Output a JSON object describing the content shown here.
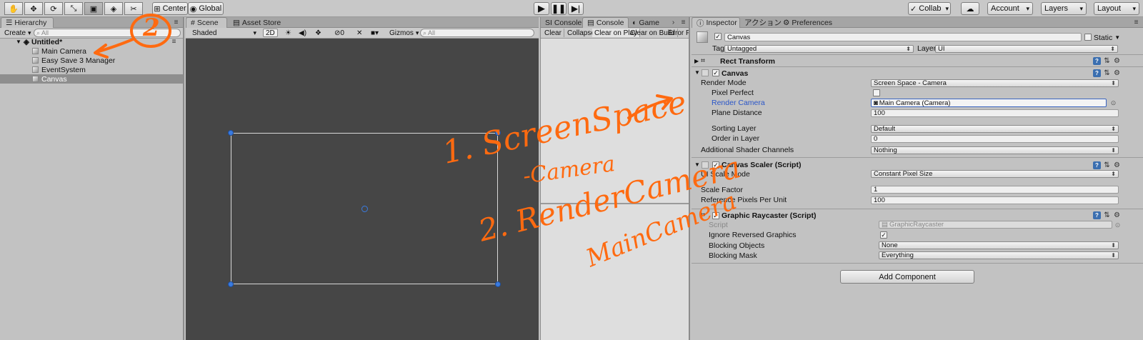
{
  "toolbar": {
    "tools": [
      "hand-tool",
      "move-tool",
      "rotate-tool",
      "scale-tool",
      "rect-tool",
      "transform-tool",
      "custom-tool"
    ],
    "pivot_label": "Center",
    "space_label": "Global",
    "collab_label": "Collab",
    "account_label": "Account",
    "layers_label": "Layers",
    "layout_label": "Layout"
  },
  "hierarchy": {
    "tab_label": "Hierarchy",
    "create_label": "Create",
    "search_placeholder": "All",
    "scene_name": "Untitled*",
    "items": [
      "Main Camera",
      "Easy Save 3 Manager",
      "EventSystem",
      "Canvas"
    ]
  },
  "scene": {
    "tabs": [
      "Scene",
      "Asset Store"
    ],
    "shading_mode": "Shaded",
    "mode_2d": "2D",
    "fx_count": "0",
    "gizmos_label": "Gizmos",
    "search_placeholder": "All"
  },
  "console": {
    "tabs": [
      "SI Console",
      "Console",
      "Game"
    ],
    "buttons": [
      "Clear",
      "Collapse",
      "Clear on Play",
      "Clear on Build",
      "Error Pause"
    ]
  },
  "inspector": {
    "tabs": [
      "Inspector",
      "アクション",
      "Preferences"
    ],
    "object_name": "Canvas",
    "static_label": "Static",
    "tag_label": "Tag",
    "tag_value": "Untagged",
    "layer_label": "Layer",
    "layer_value": "UI",
    "rect_transform": "Rect Transform",
    "canvas": {
      "title": "Canvas",
      "render_mode_label": "Render Mode",
      "render_mode_value": "Screen Space - Camera",
      "pixel_perfect_label": "Pixel Perfect",
      "render_camera_label": "Render Camera",
      "render_camera_value": "Main Camera (Camera)",
      "plane_distance_label": "Plane Distance",
      "plane_distance_value": "100",
      "sorting_layer_label": "Sorting Layer",
      "sorting_layer_value": "Default",
      "order_in_layer_label": "Order in Layer",
      "order_in_layer_value": "0",
      "shader_channels_label": "Additional Shader Channels",
      "shader_channels_value": "Nothing"
    },
    "canvas_scaler": {
      "title": "Canvas Scaler (Script)",
      "ui_scale_mode_label": "UI Scale Mode",
      "ui_scale_mode_value": "Constant Pixel Size",
      "scale_factor_label": "Scale Factor",
      "scale_factor_value": "1",
      "ref_ppu_label": "Reference Pixels Per Unit",
      "ref_ppu_value": "100"
    },
    "graphic_raycaster": {
      "title": "Graphic Raycaster (Script)",
      "script_label": "Script",
      "script_value": "GraphicRaycaster",
      "ignore_reversed_label": "Ignore Reversed Graphics",
      "blocking_objects_label": "Blocking Objects",
      "blocking_objects_value": "None",
      "blocking_mask_label": "Blocking Mask",
      "blocking_mask_value": "Everything"
    },
    "add_component_label": "Add Component"
  },
  "annotations": {
    "circle_number": "2",
    "line1a": "1. ScreenSpace",
    "line1b": "-Camera",
    "line2a": "2. RenderCamera",
    "line2b": "MainCamera"
  },
  "colors": {
    "accent_orange": "#ff6a10",
    "selection": "#3d6dbf",
    "scene_bg": "#464646"
  }
}
